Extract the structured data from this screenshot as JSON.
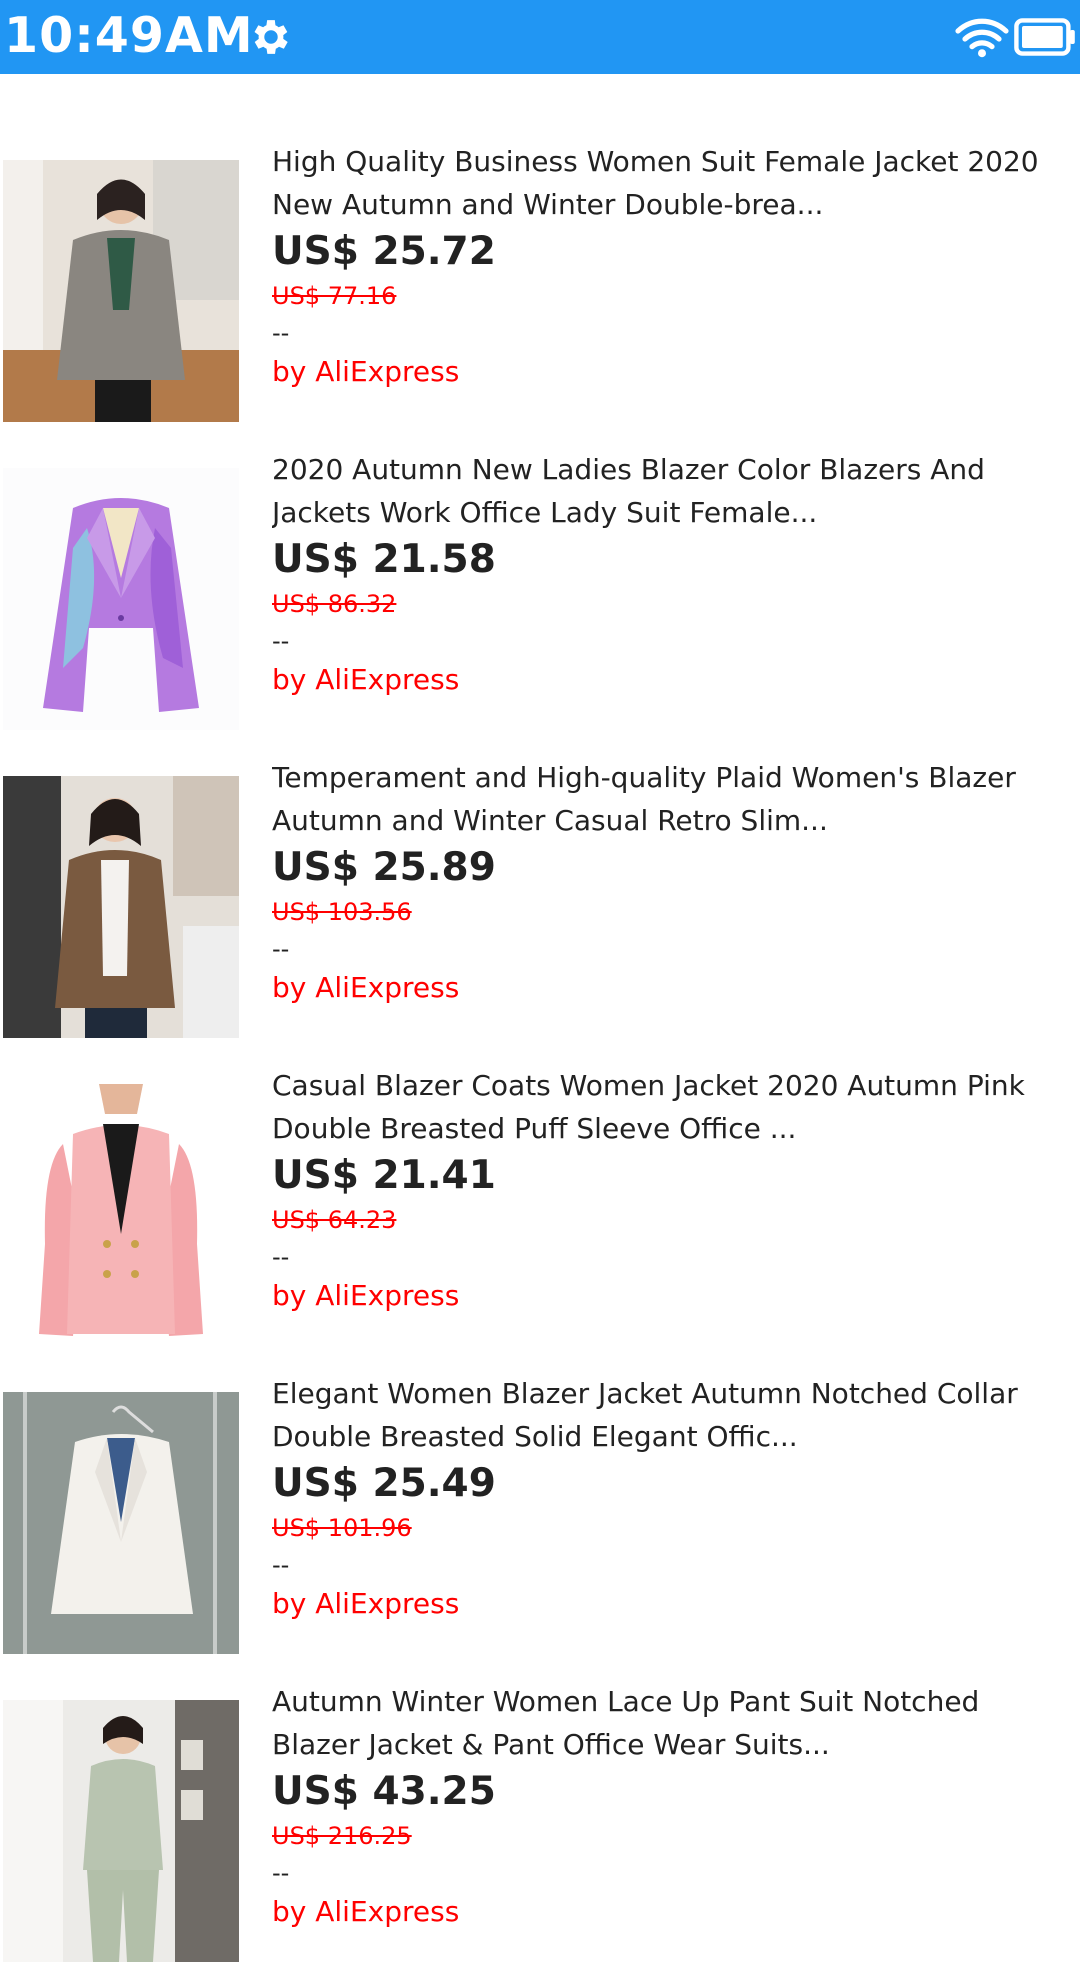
{
  "status_bar": {
    "time": "10:49AM",
    "background": "#2196F3",
    "icons": [
      "gear-icon",
      "wifi-icon",
      "battery-icon"
    ]
  },
  "products": [
    {
      "title": "High Quality Business Women Suit Female Jacket 2020 New Autumn and Winter Double-brea...",
      "price": "US$ 25.72",
      "original_price": "US$ 77.16",
      "rating": "--",
      "seller": "by AliExpress",
      "image": "gray-plaid-blazer-photo"
    },
    {
      "title": "2020 Autumn New Ladies Blazer Color Blazers And Jackets Work Office Lady Suit Female...",
      "price": "US$ 21.58",
      "original_price": "US$ 86.32",
      "rating": "--",
      "seller": "by AliExpress",
      "image": "tie-dye-purple-blazer-photo"
    },
    {
      "title": "Temperament and High-quality Plaid Women's Blazer Autumn and Winter Casual Retro Slim...",
      "price": "US$ 25.89",
      "original_price": "US$ 103.56",
      "rating": "--",
      "seller": "by AliExpress",
      "image": "brown-plaid-blazer-photo"
    },
    {
      "title": "Casual Blazer Coats Women Jacket 2020 Autumn Pink Double Breasted Puff Sleeve Office ...",
      "price": "US$ 21.41",
      "original_price": "US$ 64.23",
      "rating": "--",
      "seller": "by AliExpress",
      "image": "pink-puff-sleeve-blazer-photo"
    },
    {
      "title": "Elegant Women Blazer Jacket Autumn Notched Collar Double Breasted Solid Elegant Offic...",
      "price": "US$ 25.49",
      "original_price": "US$ 101.96",
      "rating": "--",
      "seller": "by AliExpress",
      "image": "white-blazer-on-hanger-photo"
    },
    {
      "title": "Autumn Winter Women Lace Up Pant Suit Notched Blazer Jacket & Pant Office Wear Suits...",
      "price": "US$ 43.25",
      "original_price": "US$ 216.25",
      "rating": "--",
      "seller": "by AliExpress",
      "image": "sage-pant-suit-photo"
    }
  ],
  "colors": {
    "accent": "#2196F3",
    "sale_red": "#ff0000",
    "text": "#222222"
  }
}
